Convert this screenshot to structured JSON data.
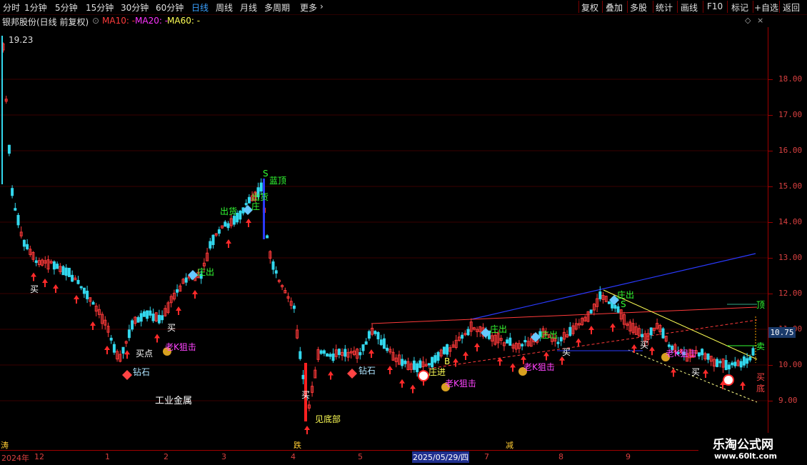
{
  "menu": {
    "periods": [
      "分时",
      "1分钟",
      "5分钟",
      "15分钟",
      "30分钟",
      "60分钟",
      "日线",
      "周线",
      "月线",
      "多周期",
      "更多"
    ],
    "active_period": "日线",
    "right_buttons": [
      "复权",
      "叠加",
      "多股",
      "统计",
      "画线",
      "F10",
      "标记",
      "+自选",
      "返回"
    ]
  },
  "info": {
    "title": "银邦股份(日线 前复权)",
    "ma10": "MA10: -",
    "ma20": "MA20: -",
    "ma60": "MA60: -",
    "colors": {
      "ma10": "#ff3b3b",
      "ma20": "#ff33ff",
      "ma60": "#ffff55"
    }
  },
  "price_axis": {
    "ticks": [
      "18.00",
      "17.00",
      "16.00",
      "15.00",
      "14.00",
      "13.00",
      "12.00",
      "11.00",
      "10.00",
      "9.00"
    ],
    "current_price": "10.75",
    "high_label": "19.23"
  },
  "bottom_axis": {
    "labels": [
      "涛",
      "2024年",
      "12",
      "1",
      "2",
      "3",
      "4",
      "跌",
      "5",
      "6",
      "7",
      "减",
      "8",
      "9"
    ],
    "highlight": "2025/05/29/四"
  },
  "annotations": [
    {
      "text": "买",
      "color": "#ffffff"
    },
    {
      "text": "买点",
      "color": "#ffffff"
    },
    {
      "text": "钻石",
      "color": "#aee4ff"
    },
    {
      "text": "买",
      "color": "#ffffff"
    },
    {
      "text": "老K狙击",
      "color": "#ff44ff"
    },
    {
      "text": "工业金属",
      "color": "#ffffff"
    },
    {
      "text": "出货",
      "color": "#33ff33"
    },
    {
      "text": "庄出",
      "color": "#33ff33"
    },
    {
      "text": "蓝顶",
      "color": "#33ff33"
    },
    {
      "text": "S",
      "color": "#33ff33"
    },
    {
      "text": "出货",
      "color": "#33ff33"
    },
    {
      "text": "庄",
      "color": "#33ff33"
    },
    {
      "text": "买",
      "color": "#ffffff"
    },
    {
      "text": "见底部",
      "color": "#ffff55"
    },
    {
      "text": "钻石",
      "color": "#aee4ff"
    },
    {
      "text": "庄进",
      "color": "#ffff55"
    },
    {
      "text": "老K狙击",
      "color": "#ff44ff"
    },
    {
      "text": "庄出",
      "color": "#33ff33"
    },
    {
      "text": "庄出",
      "color": "#33ff33"
    },
    {
      "text": "老K狙击",
      "color": "#ff44ff"
    },
    {
      "text": "买",
      "color": "#ffffff"
    },
    {
      "text": "庄出",
      "color": "#33ff33"
    },
    {
      "text": "S",
      "color": "#33ff33"
    },
    {
      "text": "买",
      "color": "#ffffff"
    },
    {
      "text": "老K狙击",
      "color": "#ff44ff"
    },
    {
      "text": "买",
      "color": "#ffffff"
    },
    {
      "text": "顶",
      "color": "#33ff33"
    },
    {
      "text": "卖",
      "color": "#33ff33"
    },
    {
      "text": "买",
      "color": "#ff4444"
    },
    {
      "text": "底",
      "color": "#ff4444"
    },
    {
      "text": "B",
      "color": "#ffff55"
    }
  ],
  "watermark": {
    "title": "乐淘公式网",
    "url": "www.60lt.com"
  }
}
